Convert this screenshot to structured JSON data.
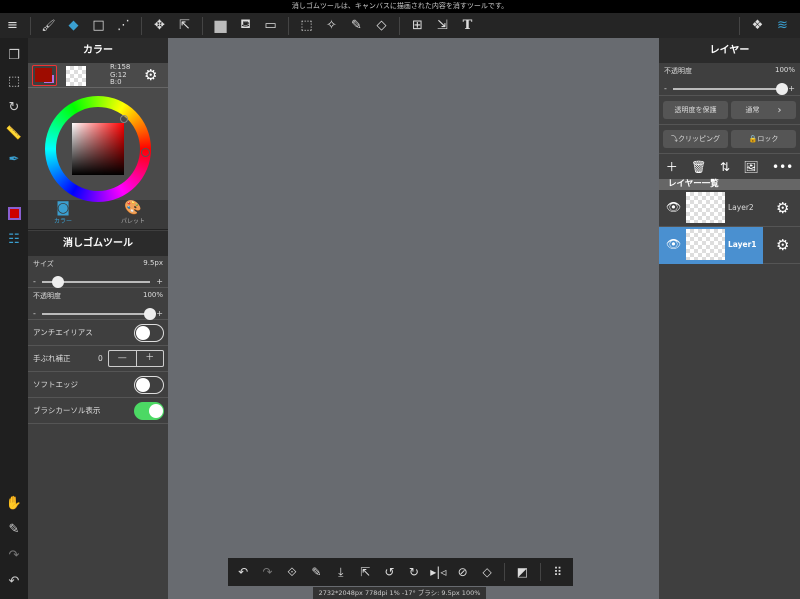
{
  "message": "消しゴムツールは、キャンバスに描画された内容を消すツールです。",
  "toolbar": {
    "menu": "≡",
    "brush": "🖌",
    "eraser": "◆",
    "shape": "□",
    "dots": "⋰",
    "move": "✥",
    "transform": "⇱",
    "fill_color": "■",
    "bucket": "⛾",
    "gradient": "▭",
    "select": "⬚",
    "magic_wand": "✧",
    "select_pen": "✎",
    "select_eraser": "◇",
    "frame": "⊞",
    "select_move": "⇲",
    "text": "T",
    "material": "❖",
    "layers": "≋"
  },
  "color_panel": {
    "title": "カラー",
    "rgb": {
      "r": "R:158",
      "g": "G:12",
      "b": "B:0"
    },
    "fg_color": "#9e0c00",
    "bg_swatch_accent": "#b36fe0",
    "tabs": [
      {
        "label": "カラー",
        "icon": "color-icon",
        "active": true
      },
      {
        "label": "パレット",
        "icon": "palette-icon",
        "active": false
      }
    ]
  },
  "eraser_panel": {
    "title": "消しゴムツール",
    "size_label": "サイズ",
    "size_value": "9.5px",
    "size_fraction": 0.15,
    "opacity_label": "不透明度",
    "opacity_value": "100%",
    "opacity_fraction": 1.0,
    "antialias_label": "アンチエイリアス",
    "antialias_on": false,
    "stabilizer_label": "手ぶれ補正",
    "stabilizer_value": "0",
    "minus": "—",
    "plus": "＋",
    "soft_edge_label": "ソフトエッジ",
    "soft_edge_on": false,
    "cursor_label": "ブラシカーソル表示",
    "cursor_on": true,
    "slider_minus": "-",
    "slider_plus": "+"
  },
  "layer_panel": {
    "title": "レイヤー",
    "opacity_label": "不透明度",
    "opacity_value": "100%",
    "protect_alpha": "透明度を保護",
    "blend_mode": "通常",
    "clipping": "クリッピング",
    "lock": "ロック",
    "list_title": "レイヤー一覧",
    "layers": [
      {
        "name": "Layer2",
        "selected": false
      },
      {
        "name": "Layer1",
        "selected": true
      }
    ],
    "accent": "#4a90d0"
  },
  "status": "2732*2048px 778dpi 1% -17° ブラシ: 9.5px 100%"
}
